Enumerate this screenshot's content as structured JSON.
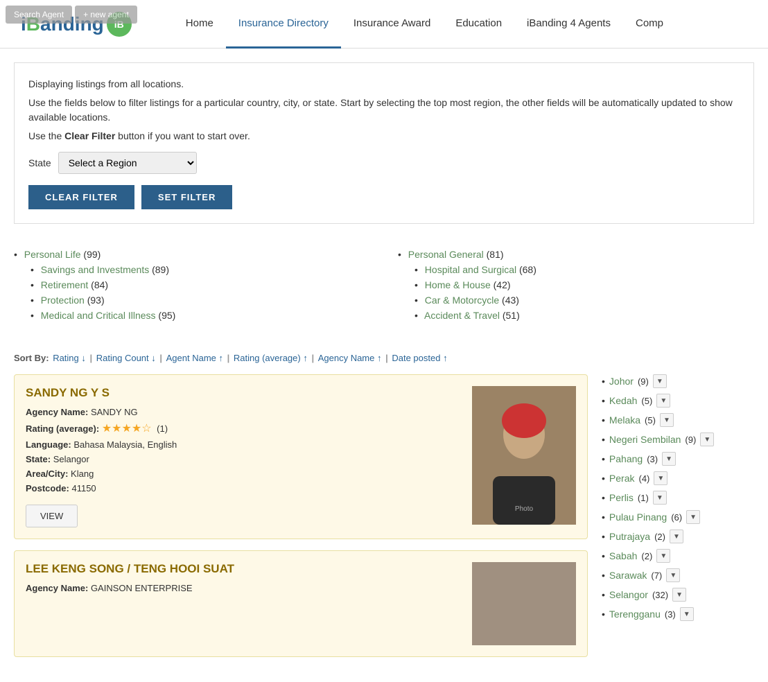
{
  "header": {
    "logo_text": "iBanding",
    "logo_badge": "iB",
    "search_agent_label": "Search Agent",
    "new_agent_label": "+ new agent",
    "nav": [
      {
        "id": "home",
        "label": "Home",
        "active": false
      },
      {
        "id": "insurance-directory",
        "label": "Insurance Directory",
        "active": true
      },
      {
        "id": "insurance-award",
        "label": "Insurance Award",
        "active": false
      },
      {
        "id": "education",
        "label": "Education",
        "active": false
      },
      {
        "id": "ibanding-agents",
        "label": "iBanding 4 Agents",
        "active": false
      },
      {
        "id": "comp",
        "label": "Comp",
        "active": false
      }
    ]
  },
  "filter": {
    "displaying_text": "Displaying listings from all locations.",
    "instruction1": "Use the fields below to filter listings for a particular country, city, or state. Start by selecting the top most region, the other fields will be automatically updated to show available locations.",
    "instruction2": "Use the ",
    "clear_filter_inline": "Clear Filter",
    "instruction2b": " button if you want to start over.",
    "state_label": "State",
    "state_placeholder": "Select a Region",
    "clear_filter_btn": "CLEAR FILTER",
    "set_filter_btn": "SET FILTER"
  },
  "categories": {
    "col1": [
      {
        "label": "Personal Life",
        "count": "(99)",
        "sub": [
          {
            "label": "Savings and Investments",
            "count": "(89)"
          },
          {
            "label": "Retirement",
            "count": "(84)"
          },
          {
            "label": "Protection",
            "count": "(93)"
          },
          {
            "label": "Medical and Critical Illness",
            "count": "(95)"
          }
        ]
      }
    ],
    "col2": [
      {
        "label": "Personal General",
        "count": "(81)",
        "sub": [
          {
            "label": "Hospital and Surgical",
            "count": "(68)"
          },
          {
            "label": "Home & House",
            "count": "(42)"
          },
          {
            "label": "Car & Motorcycle",
            "count": "(43)"
          },
          {
            "label": "Accident & Travel",
            "count": "(51)"
          }
        ]
      }
    ]
  },
  "sort": {
    "label": "Sort By:",
    "items": [
      {
        "label": "Rating ↓",
        "sep": true
      },
      {
        "label": "Rating Count ↓",
        "sep": true
      },
      {
        "label": "Agent Name ↑",
        "sep": true
      },
      {
        "label": "Rating (average) ↑",
        "sep": true
      },
      {
        "label": "Agency Name ↑",
        "sep": true
      },
      {
        "label": "Date posted ↑",
        "sep": false
      }
    ]
  },
  "agents": [
    {
      "id": "sandy-ng",
      "name": "SANDY NG Y S",
      "agency_label": "Agency Name:",
      "agency_value": "SANDY NG",
      "rating_label": "Rating (average):",
      "rating_value": 4,
      "rating_count": "(1)",
      "language_label": "Language:",
      "language_value": "Bahasa Malaysia, English",
      "state_label": "State:",
      "state_value": "Selangor",
      "area_label": "Area/City:",
      "area_value": "Klang",
      "postcode_label": "Postcode:",
      "postcode_value": "41150",
      "view_btn": "VIEW",
      "has_photo": true,
      "photo_color": "#8b7355"
    },
    {
      "id": "lee-keng-song",
      "name": "LEE KENG SONG / TENG HOOI SUAT",
      "agency_label": "Agency Name:",
      "agency_value": "GAINSON ENTERPRISE",
      "has_photo": true,
      "photo_color": "#a09080"
    }
  ],
  "sidebar": {
    "regions": [
      {
        "label": "Johor",
        "count": "(9)",
        "has_dropdown": true
      },
      {
        "label": "Kedah",
        "count": "(5)",
        "has_dropdown": true
      },
      {
        "label": "Melaka",
        "count": "(5)",
        "has_dropdown": true
      },
      {
        "label": "Negeri Sembilan",
        "count": "(9)",
        "has_dropdown": true
      },
      {
        "label": "Pahang",
        "count": "(3)",
        "has_dropdown": true
      },
      {
        "label": "Perak",
        "count": "(4)",
        "has_dropdown": true
      },
      {
        "label": "Perlis",
        "count": "(1)",
        "has_dropdown": true
      },
      {
        "label": "Pulau Pinang",
        "count": "(6)",
        "has_dropdown": true
      },
      {
        "label": "Putrajaya",
        "count": "(2)",
        "has_dropdown": true
      },
      {
        "label": "Sabah",
        "count": "(2)",
        "has_dropdown": true
      },
      {
        "label": "Sarawak",
        "count": "(7)",
        "has_dropdown": true
      },
      {
        "label": "Selangor",
        "count": "(32)",
        "has_dropdown": true
      },
      {
        "label": "Terengganu",
        "count": "(3)",
        "has_dropdown": true
      }
    ]
  }
}
